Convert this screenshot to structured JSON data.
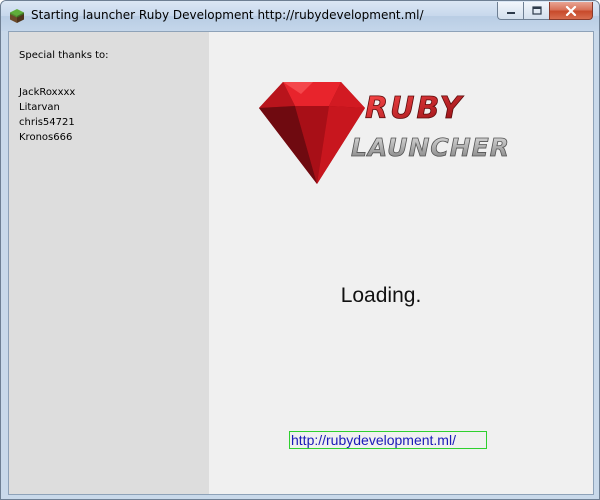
{
  "window": {
    "title": "Starting launcher Ruby Development http://rubydevelopment.ml/",
    "app_icon": "grass-block-icon",
    "buttons": [
      "minimize-icon",
      "maximize-icon",
      "close-icon"
    ]
  },
  "sidebar": {
    "thanks_title": "Special thanks to:",
    "contributors": [
      "JackRoxxxx",
      "Litarvan",
      "chris54721",
      "Kronos666"
    ]
  },
  "main": {
    "logo": {
      "line1": "RUBY",
      "line2": "LAUNCHER",
      "icon": "ruby-gem-icon",
      "colors": {
        "ruby": "#c4121a",
        "launcher": "#a9a9a9"
      }
    },
    "status": "Loading.",
    "link": "http://rubydevelopment.ml/"
  },
  "colors": {
    "sidebar_bg": "#dddddd",
    "content_bg": "#f0f0f0",
    "link": "#1a1ab8",
    "link_border": "#2fd02f"
  }
}
